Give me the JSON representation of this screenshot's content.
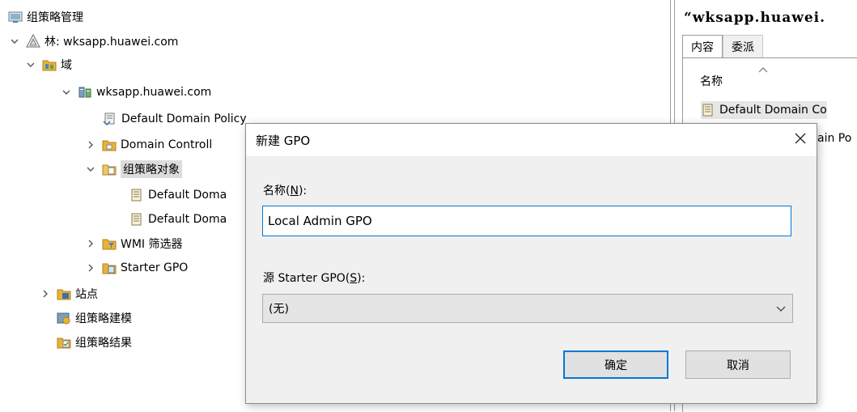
{
  "tree": {
    "root": {
      "label": "组策略管理",
      "icon": "gpm-console-icon"
    },
    "forest": {
      "label": "林: wksapp.huawei.com",
      "icon": "forest-triangle-icon",
      "expanded": true
    },
    "domains": {
      "label": "域",
      "icon": "domains-folder-icon",
      "expanded": true
    },
    "domain": {
      "label": "wksapp.huawei.com",
      "icon": "domain-icon",
      "expanded": true
    },
    "default_domain_policy": {
      "label": "Default Domain Policy",
      "icon": "gpo-link-icon"
    },
    "domain_controllers": {
      "label": "Domain Controll",
      "icon": "ou-folder-icon",
      "expanded": false
    },
    "gpo_objects": {
      "label": "组策略对象",
      "icon": "gpo-folder-icon",
      "expanded": true,
      "selected": true
    },
    "gpo_item_1": {
      "label": "Default Doma",
      "icon": "gpo-scroll-icon"
    },
    "gpo_item_2": {
      "label": "Default Doma",
      "icon": "gpo-scroll-icon"
    },
    "wmi_filters": {
      "label": "WMI 筛选器",
      "icon": "wmi-folder-icon",
      "expanded": false
    },
    "starter_gpo": {
      "label": "Starter GPO",
      "icon": "starter-folder-icon",
      "expanded": false
    },
    "sites": {
      "label": "站点",
      "icon": "sites-folder-icon",
      "expanded": false
    },
    "gp_modeling": {
      "label": "组策略建模",
      "icon": "modeling-icon"
    },
    "gp_results": {
      "label": "组策略结果",
      "icon": "results-icon"
    }
  },
  "right_pane": {
    "title": "“wksapp.huawei.",
    "tabs": [
      "内容",
      "委派"
    ],
    "active_tab": 0,
    "column_header": "名称",
    "rows": [
      "Default Domain Co",
      "ain Po"
    ]
  },
  "dialog": {
    "title": "新建 GPO",
    "name_label_prefix": "名称(",
    "name_label_key": "N",
    "name_label_suffix": "):",
    "name_value": "Local Admin GPO",
    "starter_label_prefix": "源 Starter GPO(",
    "starter_label_key": "S",
    "starter_label_suffix": "):",
    "starter_value": "(无)",
    "ok_label": "确定",
    "cancel_label": "取消"
  },
  "colors": {
    "accent": "#0078d7",
    "folder_yellow": "#e8b33a",
    "selection_grey": "#dcdcdc"
  }
}
